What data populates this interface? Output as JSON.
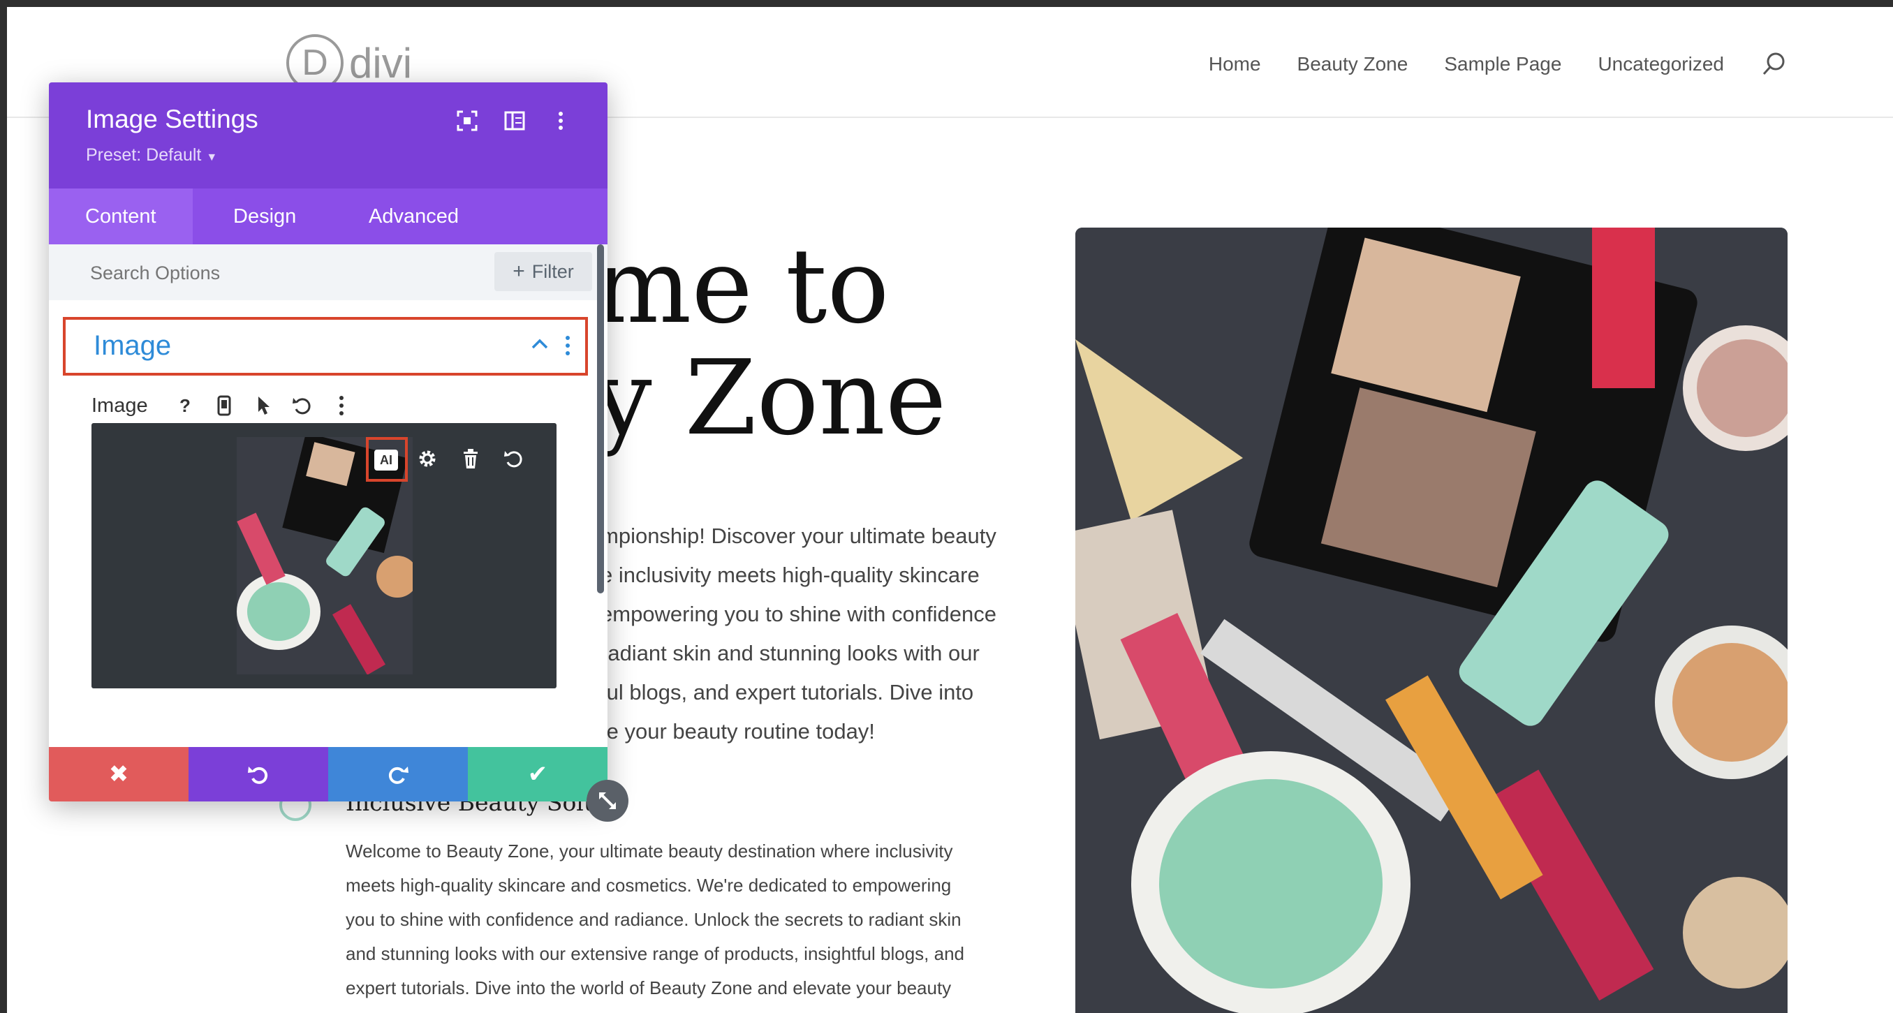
{
  "site": {
    "logo_letter": "D",
    "logo_text": "divi",
    "nav": [
      "Home",
      "Beauty Zone",
      "Sample Page",
      "Uncategorized"
    ]
  },
  "hero": {
    "title_line1": "me to",
    "title_line2": "y Zone",
    "para_lines": [
      "mpionship! Discover your ultimate beauty",
      "e inclusivity meets high-quality skincare",
      "empowering you to shine with confidence",
      "radiant skin and stunning looks with our",
      "ful blogs, and expert tutorials. Dive into",
      "te your beauty routine today!"
    ],
    "feature_title": "Inclusive Beauty Solutio",
    "feature_lines": [
      "Welcome to Beauty Zone, your ultimate beauty destination where inclusivity",
      "meets high-quality skincare and cosmetics. We're dedicated to empowering",
      "you to shine with confidence and radiance. Unlock the secrets to radiant skin",
      "and stunning looks with our extensive range of products, insightful blogs, and",
      "expert tutorials. Dive into the world of Beauty Zone and elevate your beauty"
    ]
  },
  "panel": {
    "title": "Image Settings",
    "preset": "Preset: Default",
    "tabs": [
      "Content",
      "Design",
      "Advanced"
    ],
    "search_placeholder": "Search Options",
    "filter_label": "Filter",
    "section_title": "Image",
    "option_label": "Image",
    "ai_badge": "AI"
  },
  "colors": {
    "panel_header": "#7b3fd8",
    "cancel": "#e15b5b",
    "undo": "#7b3fd8",
    "redo": "#3f86d8",
    "save": "#43c39d",
    "highlight": "#d8452c"
  }
}
